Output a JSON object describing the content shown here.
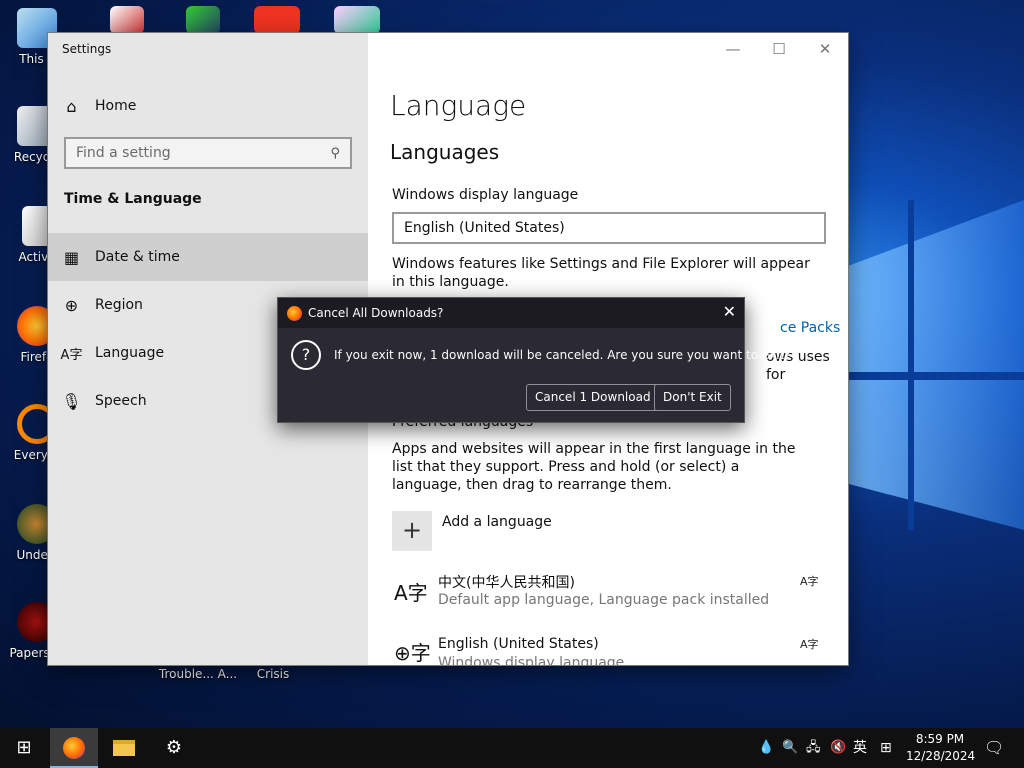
{
  "desktop": {
    "icons": [
      {
        "label": "This P"
      },
      {
        "label": "Recycle"
      },
      {
        "label": "Activa"
      },
      {
        "label": "Firefo"
      },
      {
        "label": "Everyth"
      },
      {
        "label": "Undert"
      },
      {
        "label": "Papers, P"
      },
      {
        "label": "Trouble... A..."
      },
      {
        "label": "Crisis"
      }
    ]
  },
  "settings": {
    "window_title": "Settings",
    "sidebar": {
      "home": "Home",
      "search_placeholder": "Find a setting",
      "section": "Time & Language",
      "items": [
        {
          "label": "Date & time",
          "icon": "calendar-clock-icon"
        },
        {
          "label": "Region",
          "icon": "globe-icon"
        },
        {
          "label": "Language",
          "icon": "language-icon"
        },
        {
          "label": "Speech",
          "icon": "microphone-icon"
        }
      ]
    },
    "main": {
      "title": "Language",
      "section": "Languages",
      "display_label": "Windows display language",
      "display_value": "English (United States)",
      "display_desc": "Windows features like Settings and File Explorer will appear in this language.",
      "link_partial": "ce Packs",
      "partial_text": "ows uses for",
      "preferred_heading": "Preferred languages",
      "preferred_desc": "Apps and websites will appear in the first language in the list that they support. Press and hold (or select) a language, then drag to rearrange them.",
      "add_language": "Add a language",
      "languages": [
        {
          "name": "中文(中华人民共和国)",
          "sub": "Default app language, Language pack installed"
        },
        {
          "name": "English (United States)",
          "sub": "Windows display language"
        }
      ]
    }
  },
  "dialog": {
    "title": "Cancel All Downloads?",
    "message": "If you exit now, 1 download will be canceled. Are you sure you want to exit?",
    "cancel_button": "Cancel 1 Download",
    "dont_exit_button": "Don't Exit"
  },
  "taskbar": {
    "ime": "英",
    "time": "8:59 PM",
    "date": "12/28/2024"
  }
}
